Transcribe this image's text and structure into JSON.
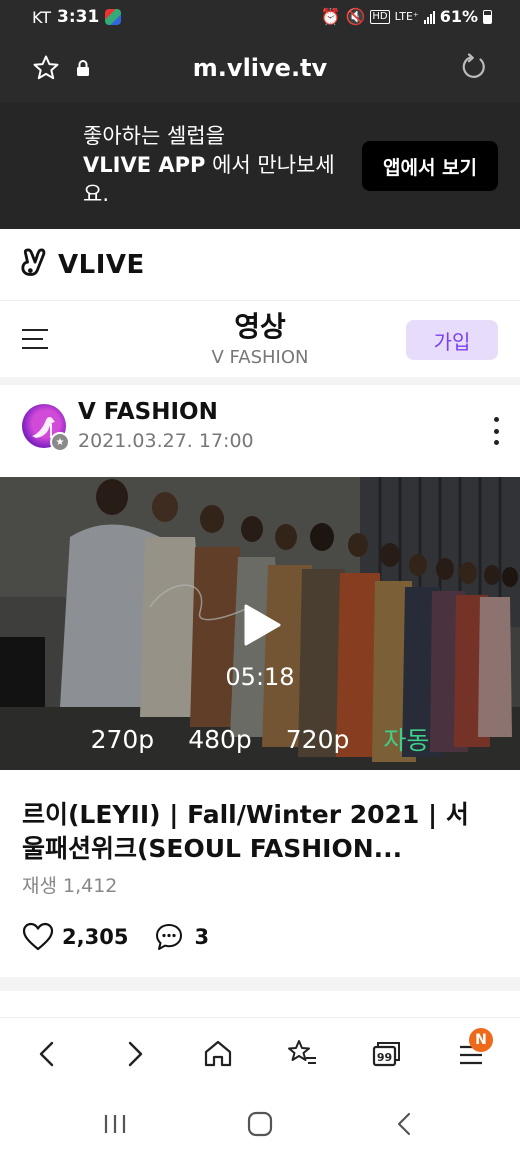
{
  "status_bar": {
    "carrier": "KT",
    "time": "3:31",
    "network": "LTE⁺",
    "hd_label": "HD",
    "battery": "61%"
  },
  "browser": {
    "url": "m.vlive.tv"
  },
  "app_banner": {
    "line1": "좋아하는 셀럽을",
    "line2_app": "VLIVE APP",
    "line2_rest": " 에서 만나보세",
    "line3": "요.",
    "open_button": "앱에서 보기"
  },
  "site": {
    "logo_text": "VLIVE"
  },
  "channel": {
    "title": "영상",
    "subtitle": "V FASHION",
    "join_button": "가입"
  },
  "post": {
    "author": "V FASHION",
    "date": "2021.03.27. 17:00",
    "duration": "05:18",
    "qualities": [
      "270p",
      "480p",
      "720p",
      "자동"
    ],
    "title_line1": "르이(LEYII) | Fall/Winter 2021 | 서",
    "title_line2": "울패션위크(SEOUL FASHION...",
    "views": "재생 1,412",
    "likes": "2,305",
    "comments": "3"
  },
  "bottom_nav": {
    "badge": "N"
  },
  "colors": {
    "accent_purple": "#7b40f2",
    "join_bg": "#e8dcfb",
    "auto_quality": "#3ed08a",
    "badge_orange": "#ee6a1a",
    "banner_bg": "#262626"
  }
}
